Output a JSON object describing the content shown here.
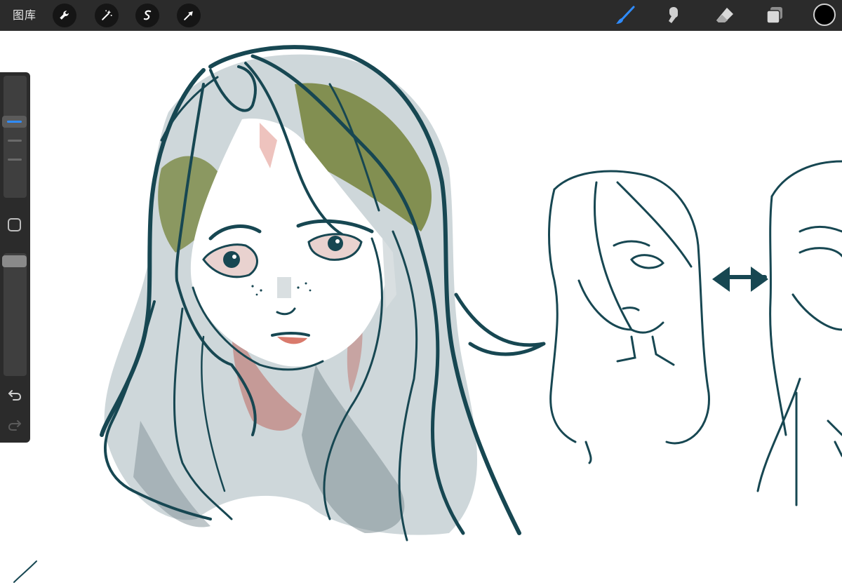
{
  "topbar": {
    "gallery_label": "图库",
    "left_tools": [
      {
        "icon": "wrench-icon",
        "name": "actions"
      },
      {
        "icon": "magic-wand-icon",
        "name": "adjustments"
      },
      {
        "icon": "selection-s-icon",
        "name": "selection"
      },
      {
        "icon": "transform-arrow-icon",
        "name": "transform"
      }
    ],
    "right_tools": [
      {
        "icon": "brush-icon",
        "name": "paint",
        "active": true
      },
      {
        "icon": "smudge-icon",
        "name": "smudge",
        "active": false
      },
      {
        "icon": "eraser-icon",
        "name": "eraser",
        "active": false
      },
      {
        "icon": "layers-icon",
        "name": "layers",
        "active": false
      }
    ],
    "current_color": "#000000"
  },
  "sidebar": {
    "brush_size_slider": {
      "icon": "size-slider"
    },
    "opacity_slider": {
      "icon": "opacity-slider"
    },
    "buttons": [
      "modify-square-icon",
      "undo-icon",
      "redo-icon"
    ]
  },
  "canvas": {
    "background": "#ffffff",
    "ink_color": "#174752",
    "accent_colors": [
      "#6f7d2e",
      "#c0716a",
      "#9fb0b6"
    ]
  }
}
